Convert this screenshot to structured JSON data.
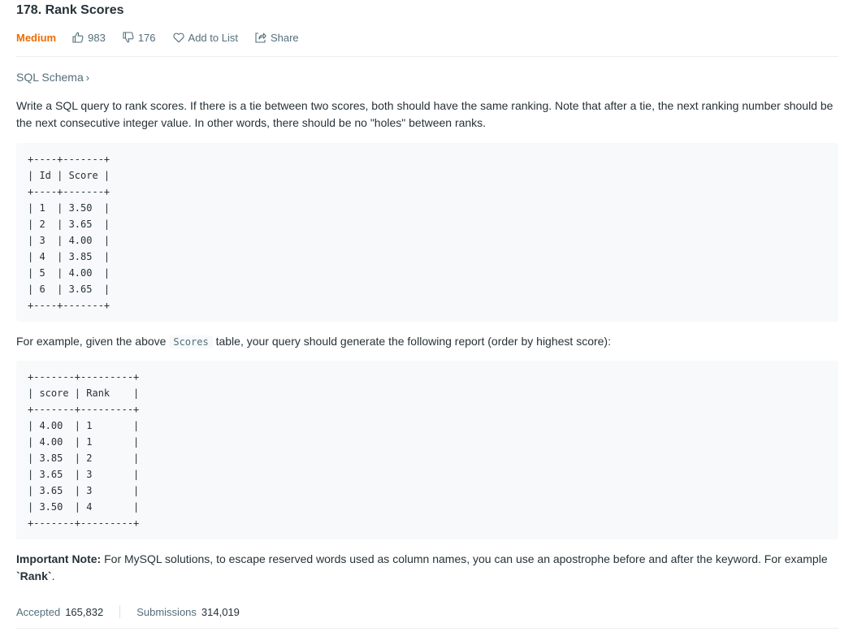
{
  "problem": {
    "title": "178. Rank Scores",
    "difficulty": "Medium",
    "likes": "983",
    "dislikes": "176",
    "add_to_list": "Add to List",
    "share": "Share",
    "schema_link": "SQL Schema",
    "schema_chevron": "›"
  },
  "description": {
    "intro": "Write a SQL query to rank scores. If there is a tie between two scores, both should have the same ranking. Note that after a tie, the next ranking number should be the next consecutive integer value. In other words, there should be no \"holes\" between ranks.",
    "example_prefix": "For example, given the above",
    "example_code": "Scores",
    "example_suffix": "table, your query should generate the following report (order by highest score):",
    "note_label": "Important Note:",
    "note_text": "For MySQL solutions, to escape reserved words used as column names, you can use an apostrophe before and after the keyword. For example",
    "note_keyword": "`Rank`",
    "note_end": "."
  },
  "input_table": "+----+-------+\n| Id | Score |\n+----+-------+\n| 1  | 3.50  |\n| 2  | 3.65  |\n| 3  | 4.00  |\n| 4  | 3.85  |\n| 5  | 4.00  |\n| 6  | 3.65  |\n+----+-------+",
  "output_table": "+-------+---------+\n| score | Rank    |\n+-------+---------+\n| 4.00  | 1       |\n| 4.00  | 1       |\n| 3.85  | 2       |\n| 3.65  | 3       |\n| 3.65  | 3       |\n| 3.50  | 4       |\n+-------+---------+",
  "stats": {
    "accepted_label": "Accepted",
    "accepted_value": "165,832",
    "submissions_label": "Submissions",
    "submissions_value": "314,019"
  },
  "colors": {
    "difficulty_medium": "#ef6c00",
    "text_primary": "#263238",
    "text_secondary": "#546e7a",
    "code_background": "#f7f9fa"
  },
  "icons": [
    "thumbs-up-icon",
    "thumbs-down-icon",
    "heart-icon",
    "share-icon"
  ]
}
